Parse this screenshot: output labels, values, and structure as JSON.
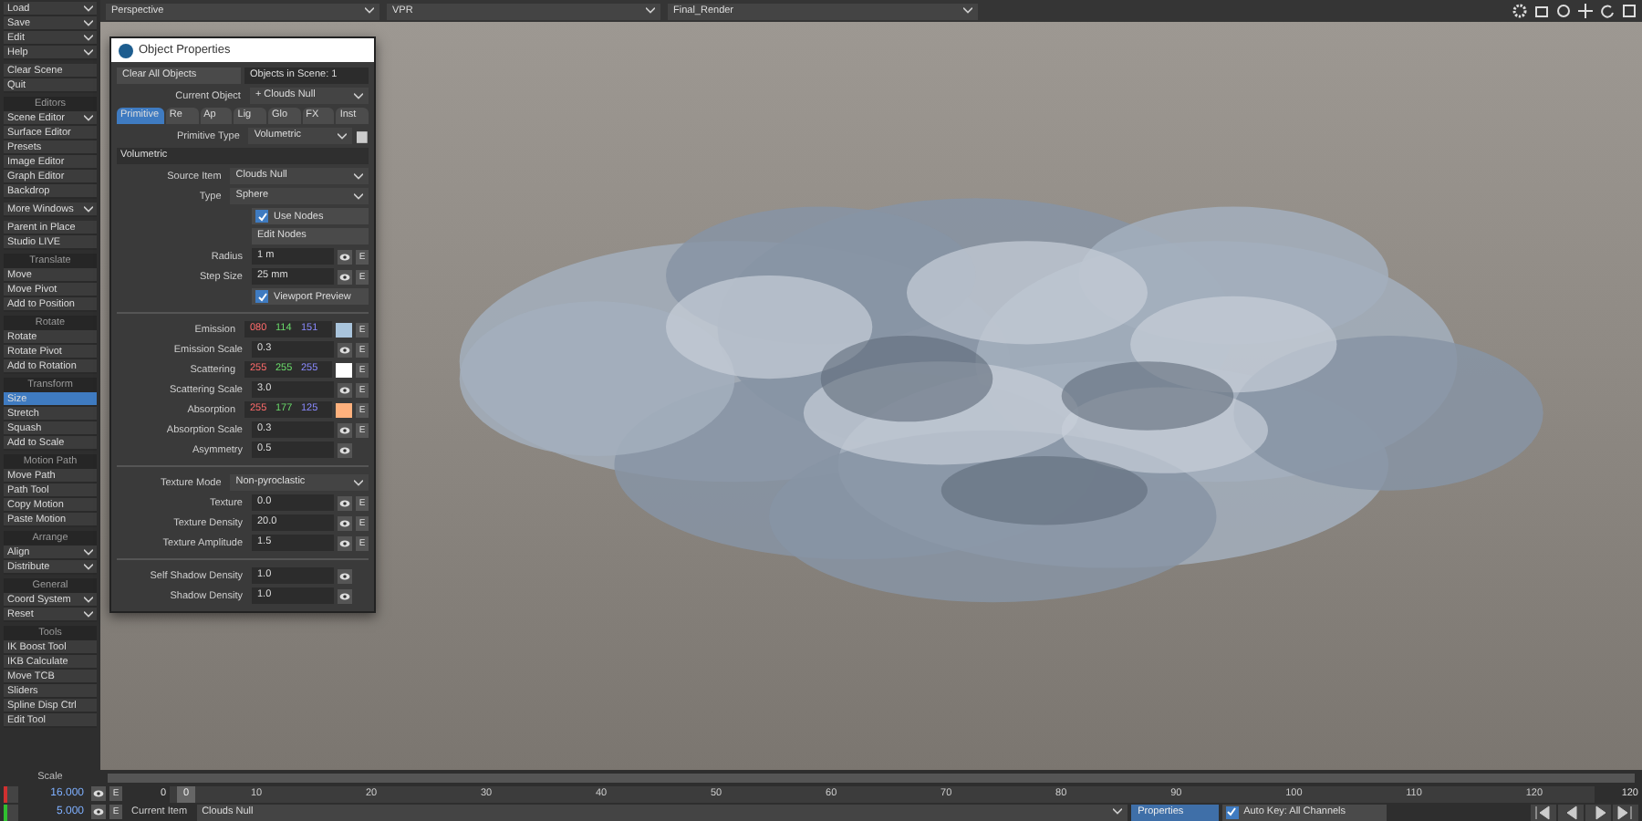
{
  "sidebar": {
    "groups": [
      {
        "items": [
          {
            "label": "Load",
            "kind": "menu",
            "selected": false
          },
          {
            "label": "Save",
            "kind": "menu",
            "selected": false
          },
          {
            "label": "Edit",
            "kind": "menu",
            "selected": false
          },
          {
            "label": "Help",
            "kind": "menu",
            "selected": false
          }
        ]
      },
      {
        "items": [
          {
            "label": "Clear Scene",
            "kind": "button",
            "selected": false
          },
          {
            "label": "Quit",
            "kind": "button",
            "selected": false
          }
        ]
      },
      {
        "header": "Editors",
        "items": [
          {
            "label": "Scene Editor",
            "kind": "menu",
            "selected": false
          },
          {
            "label": "Surface Editor",
            "kind": "button",
            "selected": false
          },
          {
            "label": "Presets",
            "kind": "button",
            "selected": false
          },
          {
            "label": "Image Editor",
            "kind": "button",
            "selected": false
          },
          {
            "label": "Graph Editor",
            "kind": "button",
            "selected": false
          },
          {
            "label": "Backdrop",
            "kind": "button",
            "selected": false
          }
        ]
      },
      {
        "items": [
          {
            "label": "More Windows",
            "kind": "menu",
            "selected": false
          }
        ]
      },
      {
        "items": [
          {
            "label": "Parent in Place",
            "kind": "button",
            "selected": false
          },
          {
            "label": "Studio LIVE",
            "kind": "button",
            "selected": false
          }
        ]
      },
      {
        "header": "Translate",
        "items": [
          {
            "label": "Move",
            "kind": "button",
            "selected": false
          },
          {
            "label": "Move Pivot",
            "kind": "button",
            "selected": false
          },
          {
            "label": "Add to Position",
            "kind": "button",
            "selected": false
          }
        ]
      },
      {
        "header": "Rotate",
        "items": [
          {
            "label": "Rotate",
            "kind": "button",
            "selected": false
          },
          {
            "label": "Rotate Pivot",
            "kind": "button",
            "selected": false
          },
          {
            "label": "Add to Rotation",
            "kind": "button",
            "selected": false
          }
        ]
      },
      {
        "header": "Transform",
        "items": [
          {
            "label": "Size",
            "kind": "button",
            "selected": true
          },
          {
            "label": "Stretch",
            "kind": "button",
            "selected": false
          },
          {
            "label": "Squash",
            "kind": "button",
            "selected": false
          },
          {
            "label": "Add to Scale",
            "kind": "button",
            "selected": false
          }
        ]
      },
      {
        "header": "Motion Path",
        "items": [
          {
            "label": "Move Path",
            "kind": "button",
            "selected": false
          },
          {
            "label": "Path Tool",
            "kind": "button",
            "selected": false
          },
          {
            "label": "Copy Motion",
            "kind": "button",
            "selected": false
          },
          {
            "label": "Paste Motion",
            "kind": "button",
            "selected": false
          }
        ]
      },
      {
        "header": "Arrange",
        "items": [
          {
            "label": "Align",
            "kind": "menu",
            "selected": false
          },
          {
            "label": "Distribute",
            "kind": "menu",
            "selected": false
          }
        ]
      },
      {
        "header": "General",
        "items": [
          {
            "label": "Coord System",
            "kind": "menu",
            "selected": false
          },
          {
            "label": "Reset",
            "kind": "menu",
            "selected": false
          }
        ]
      },
      {
        "header": "Tools",
        "items": [
          {
            "label": "IK Boost Tool",
            "kind": "button",
            "selected": false
          },
          {
            "label": "IKB Calculate",
            "kind": "button",
            "selected": false
          },
          {
            "label": "Move TCB",
            "kind": "button",
            "selected": false
          },
          {
            "label": "Sliders",
            "kind": "button",
            "selected": false
          },
          {
            "label": "Spline Disp Ctrl",
            "kind": "button",
            "selected": false
          },
          {
            "label": "Edit Tool",
            "kind": "button",
            "selected": false
          }
        ]
      }
    ]
  },
  "viewport": {
    "view": "Perspective",
    "render_mode": "VPR",
    "camera": "Final_Render"
  },
  "panel": {
    "title": "Object Properties",
    "clear_button": "Clear All Objects",
    "count": "Objects in Scene: 1",
    "current_label": "Current Object",
    "current_value": "+ Clouds Null",
    "tabs": [
      {
        "label": "Primitive",
        "selected": true
      },
      {
        "label": "Re",
        "selected": false
      },
      {
        "label": "Ap",
        "selected": false
      },
      {
        "label": "Lig",
        "selected": false
      },
      {
        "label": "Glo",
        "selected": false
      },
      {
        "label": "FX",
        "selected": false
      },
      {
        "label": "Inst",
        "selected": false
      }
    ],
    "type_label": "Primitive Type",
    "type_value": "Volumetric",
    "section": "Volumetric",
    "rows": [
      {
        "kind": "dropdown",
        "label": "Source Item",
        "value": "Clouds Null"
      },
      {
        "kind": "dropdown",
        "label": "Type",
        "value": "Sphere"
      },
      {
        "kind": "checkbox",
        "label": "Use Nodes",
        "checked": true
      },
      {
        "kind": "button",
        "label": "Edit Nodes"
      },
      {
        "kind": "number",
        "label": "Radius",
        "value": "1 m",
        "eye": true,
        "env": "E"
      },
      {
        "kind": "number",
        "label": "Step Size",
        "value": "25 mm",
        "eye": true,
        "env": "E"
      },
      {
        "kind": "checkbox",
        "label": "Viewport Preview",
        "checked": true
      },
      {
        "kind": "divider"
      },
      {
        "kind": "color",
        "label": "Emission",
        "r": "080",
        "g": "114",
        "b": "151",
        "color": "#a9c4dc",
        "env": "E"
      },
      {
        "kind": "number",
        "label": "Emission Scale",
        "value": "0.3",
        "eye": true,
        "env": "E"
      },
      {
        "kind": "color",
        "label": "Scattering",
        "r": "255",
        "g": "255",
        "b": "255",
        "color": "#ffffff",
        "env": "E"
      },
      {
        "kind": "number",
        "label": "Scattering Scale",
        "value": "3.0",
        "eye": true,
        "env": "E"
      },
      {
        "kind": "color",
        "label": "Absorption",
        "r": "255",
        "g": "177",
        "b": "125",
        "color": "#ffb17d",
        "env": "E"
      },
      {
        "kind": "number",
        "label": "Absorption Scale",
        "value": "0.3",
        "eye": true,
        "env": "E"
      },
      {
        "kind": "number",
        "label": "Asymmetry",
        "value": "0.5",
        "eye": true
      },
      {
        "kind": "divider"
      },
      {
        "kind": "dropdown",
        "label": "Texture Mode",
        "value": "Non-pyroclastic"
      },
      {
        "kind": "number",
        "label": "Texture",
        "value": "0.0",
        "eye": true,
        "env": "E"
      },
      {
        "kind": "number",
        "label": "Texture Density",
        "value": "20.0",
        "eye": true,
        "env": "E"
      },
      {
        "kind": "number",
        "label": "Texture Amplitude",
        "value": "1.5",
        "eye": true,
        "env": "E"
      },
      {
        "kind": "divider"
      },
      {
        "kind": "number",
        "label": "Self Shadow Density",
        "value": "1.0",
        "eye": true
      },
      {
        "kind": "number",
        "label": "Shadow Density",
        "value": "1.0",
        "eye": true
      }
    ]
  },
  "bottom": {
    "scale_label": "Scale",
    "grid_value": "16.000",
    "grid_env": "E",
    "step_value": "5.000",
    "step_env": "E",
    "start_frame": "0",
    "current_frame": "0",
    "timeline": {
      "level": 0
    },
    "ticks": [
      "10",
      "20",
      "30",
      "40",
      "50",
      "60",
      "70",
      "80",
      "90",
      "100",
      "110",
      "120"
    ],
    "end_frame": "120",
    "current_item_label": "Current Item",
    "current_item": "Clouds Null",
    "properties_button": "Properties",
    "auto_key": {
      "label": "Auto Key: All Channels",
      "checked": true
    }
  }
}
